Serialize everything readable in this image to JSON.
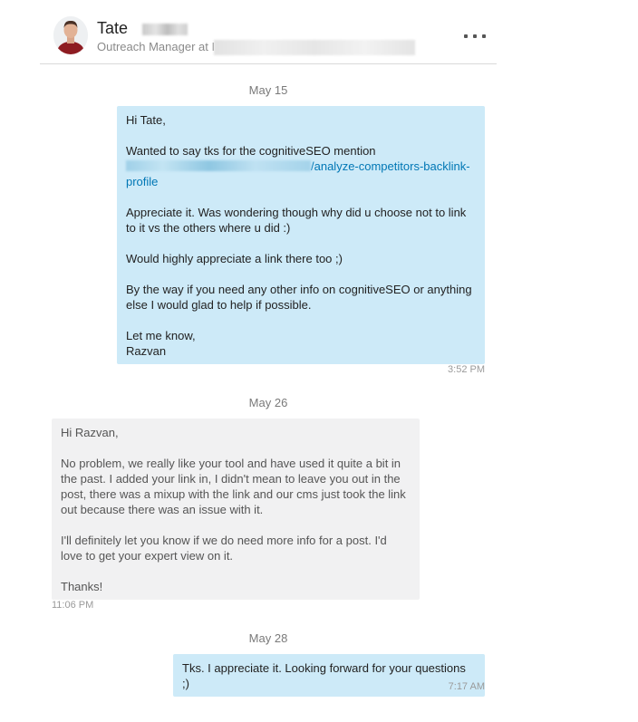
{
  "header": {
    "name": "Tate",
    "title": "Outreach Manager at",
    "title_suffix": "I",
    "more_icon": "ellipsis-icon"
  },
  "thread": {
    "days": [
      {
        "date": "May 15",
        "messages": [
          {
            "direction": "outgoing",
            "greeting": "Hi Tate,",
            "line1": "Wanted to say tks for the cognitiveSEO mention",
            "link_text": "/analyze-competitors-backlink-profile",
            "para2": "Appreciate it. Was wondering though why did u choose not to link to it vs the others where u did :)",
            "para3": "Would highly appreciate a link there too ;)",
            "para4": "By the way if you need any other info on cognitiveSEO or anything else I would glad to help if possible.",
            "sign1": "Let me know,",
            "sign2": "Razvan",
            "time": "3:52 PM"
          }
        ]
      },
      {
        "date": "May 26",
        "messages": [
          {
            "direction": "incoming",
            "greeting": "Hi Razvan,",
            "para1": "No problem, we really like your tool and have used it quite a bit in the past. I added your link in, I didn't mean to leave you out in the post, there was a mixup with the link and our cms just took the link out because there was an issue with it.",
            "para2": "I'll definitely let you know if we do need more info for a post. I'd love to get your expert view on it.",
            "para3": "Thanks!",
            "time": "11:06 PM"
          }
        ]
      },
      {
        "date": "May 28",
        "messages": [
          {
            "direction": "outgoing",
            "text": "Tks. I appreciate it. Looking forward for your questions ;)",
            "time": "7:17 AM"
          }
        ]
      }
    ]
  }
}
